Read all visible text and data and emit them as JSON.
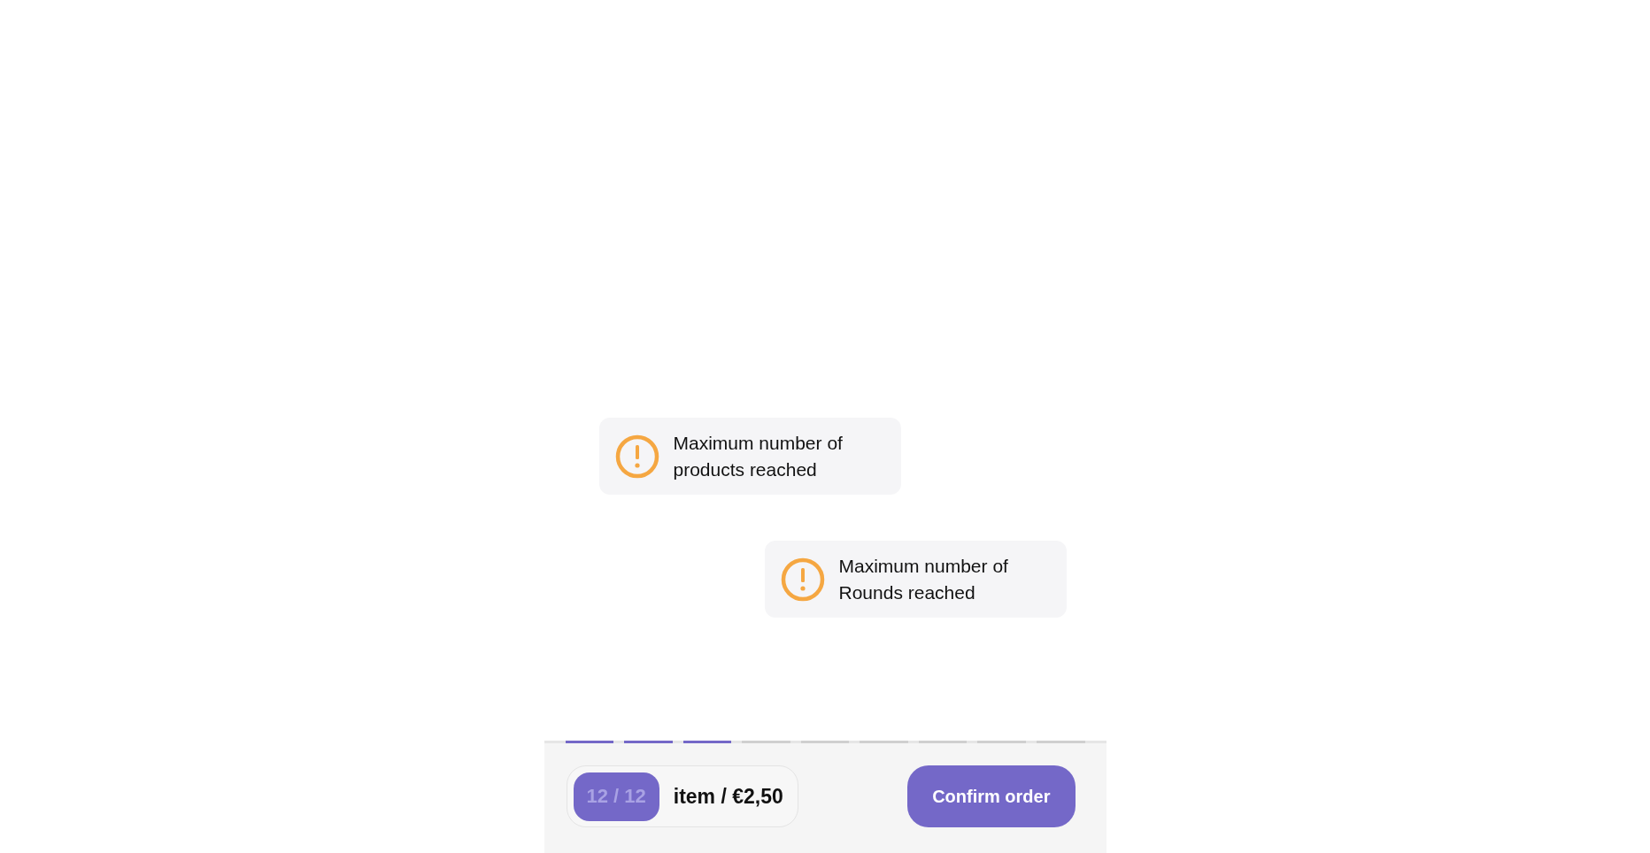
{
  "toasts": [
    {
      "message": "Maximum number of products reached"
    },
    {
      "message": "Maximum number of Rounds reached"
    }
  ],
  "progress": [
    {
      "filled": true
    },
    {
      "filled": true
    },
    {
      "filled": true
    },
    {
      "filled": false
    },
    {
      "filled": false
    },
    {
      "filled": false
    },
    {
      "filled": false
    },
    {
      "filled": false
    },
    {
      "filled": false
    }
  ],
  "summary": {
    "count": "12 / 12",
    "price": "item / €2,50"
  },
  "confirm_button": "Confirm order"
}
